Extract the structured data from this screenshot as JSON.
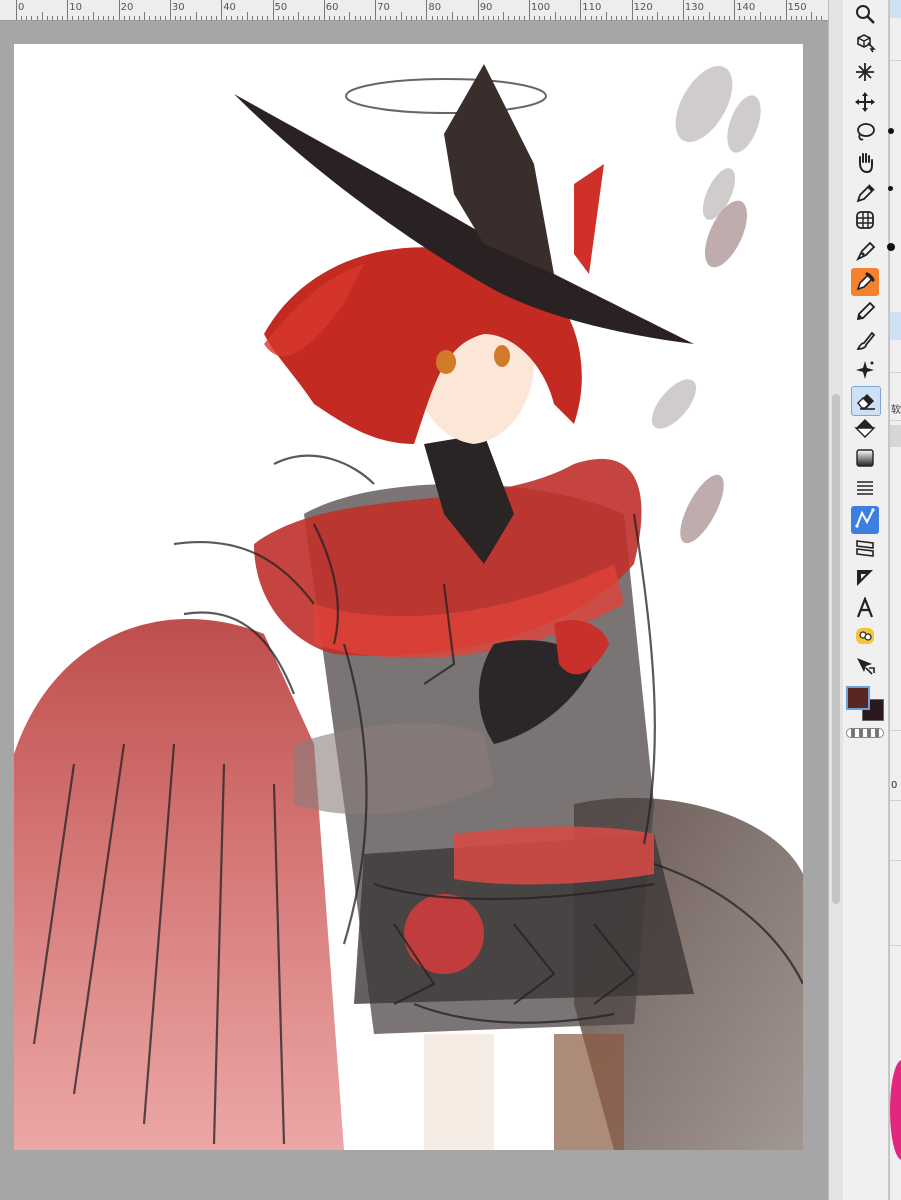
{
  "ruler": {
    "labels": [
      "0",
      "10",
      "20",
      "30",
      "40",
      "50",
      "60",
      "70",
      "80",
      "90",
      "100",
      "110",
      "120",
      "130",
      "140",
      "150"
    ]
  },
  "tools": [
    {
      "name": "zoom-icon"
    },
    {
      "name": "3d-cursor-icon"
    },
    {
      "name": "magic-wand-icon"
    },
    {
      "name": "move-icon"
    },
    {
      "name": "lasso-icon"
    },
    {
      "name": "hand-icon"
    },
    {
      "name": "eyedropper-icon"
    },
    {
      "name": "grid-transform-icon"
    },
    {
      "name": "pen-icon"
    },
    {
      "name": "marker-icon",
      "state": "active-orange"
    },
    {
      "name": "pencil-icon"
    },
    {
      "name": "brush-icon"
    },
    {
      "name": "sparkle-icon"
    },
    {
      "name": "eraser-icon",
      "state": "selected"
    },
    {
      "name": "fill-bucket-icon"
    },
    {
      "name": "gradient-icon"
    },
    {
      "name": "hatch-icon"
    },
    {
      "name": "vector-curve-icon",
      "state": "active-blue"
    },
    {
      "name": "frame-border-icon"
    },
    {
      "name": "ruler-triangle-icon"
    },
    {
      "name": "text-tool-icon"
    },
    {
      "name": "balloon-icon"
    },
    {
      "name": "object-select-icon"
    }
  ],
  "colors": {
    "main": "#5a2622",
    "sub": "#2a1a1e",
    "accent_orange": "#f3812f",
    "accent_blue": "#3d7fe0"
  },
  "right_panel": {
    "label": "软",
    "value": "0"
  }
}
